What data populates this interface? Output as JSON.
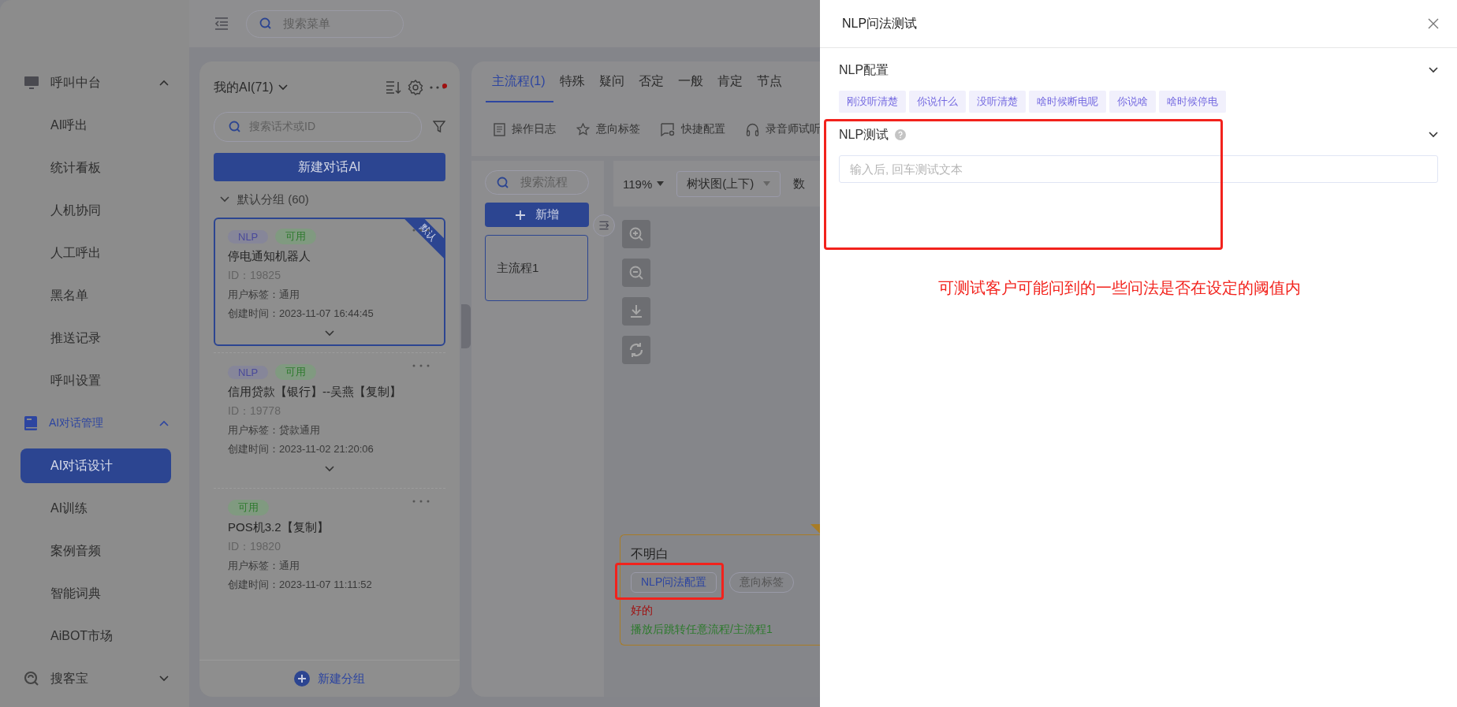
{
  "header": {
    "search_placeholder": "搜索菜单"
  },
  "sidebar": {
    "groups": [
      {
        "label": "呼叫中台",
        "active": false,
        "expanded": true,
        "children": [
          {
            "label": "AI呼出",
            "selected": false
          },
          {
            "label": "统计看板",
            "selected": false
          },
          {
            "label": "人机协同",
            "selected": false
          },
          {
            "label": "人工呼出",
            "selected": false
          },
          {
            "label": "黑名单",
            "selected": false
          },
          {
            "label": "推送记录",
            "selected": false
          },
          {
            "label": "呼叫设置",
            "selected": false
          }
        ]
      },
      {
        "label": "AI对话管理",
        "active": true,
        "expanded": true,
        "children": [
          {
            "label": "AI对话设计",
            "selected": true
          },
          {
            "label": "AI训练",
            "selected": false
          },
          {
            "label": "案例音频",
            "selected": false
          },
          {
            "label": "智能词典",
            "selected": false
          },
          {
            "label": "AiBOT市场",
            "selected": false
          }
        ]
      },
      {
        "label": "搜客宝",
        "active": false,
        "expanded": false
      }
    ]
  },
  "list_panel": {
    "title": "我的AI(71)",
    "search_placeholder": "搜索话术或ID",
    "new_button": "新建对话AI",
    "group": {
      "label": "默认分组",
      "count": "(60)",
      "expanded": true
    },
    "cards": [
      {
        "tags": [
          {
            "label": "NLP",
            "kind": "nlp"
          },
          {
            "label": "可用",
            "kind": "status"
          }
        ],
        "name": "停电通知机器人",
        "id": "ID：19825",
        "user_tag": "用户标签：通用",
        "created": "创建时间：2023-11-07 16:44:45",
        "selected": true,
        "corner_badge": "默认",
        "expand": true
      },
      {
        "tags": [
          {
            "label": "NLP",
            "kind": "nlp"
          },
          {
            "label": "可用",
            "kind": "status"
          }
        ],
        "name": "信用贷款【银行】--吴燕【复制】",
        "id": "ID：19778",
        "user_tag": "用户标签：贷款通用",
        "created": "创建时间：2023-11-02 21:20:06",
        "selected": false,
        "expand": true
      },
      {
        "tags": [
          {
            "label": "可用",
            "kind": "status"
          }
        ],
        "name": "POS机3.2【复制】",
        "id": "ID：19820",
        "user_tag": "用户标签：通用",
        "created": "创建时间：2023-11-07 11:11:52",
        "selected": false,
        "expand": false
      }
    ],
    "footer_button": "新建分组"
  },
  "main": {
    "tabs": [
      {
        "label": "主流程(1)",
        "selected": true
      },
      {
        "label": "特殊",
        "selected": false
      },
      {
        "label": "疑问",
        "selected": false
      },
      {
        "label": "否定",
        "selected": false
      },
      {
        "label": "一般",
        "selected": false
      },
      {
        "label": "肯定",
        "selected": false
      },
      {
        "label": "节点",
        "selected": false
      }
    ],
    "tools": [
      {
        "label": "操作日志",
        "kind": "log"
      },
      {
        "label": "意向标签",
        "kind": "star"
      },
      {
        "label": "快捷配置",
        "kind": "config"
      },
      {
        "label": "录音师试听",
        "kind": "headset"
      }
    ],
    "flow_search_placeholder": "搜索流程",
    "add_button": "新增",
    "flows": [
      {
        "label": "主流程1",
        "selected": true
      }
    ],
    "canvas": {
      "zoom": "119%",
      "layout": "树状图(上下)",
      "column_3": "数"
    },
    "node": {
      "title": "不明白",
      "buttons": [
        {
          "label": "NLP问法配置",
          "kind": "primary"
        },
        {
          "label": "意向标签",
          "kind": "plain"
        }
      ],
      "reply": "好的",
      "action": "播放后跳转任意流程/主流程1"
    }
  },
  "drawer": {
    "title": "NLP问法测试",
    "sections": [
      {
        "title": "NLP配置",
        "help": false,
        "tags": [
          "刚没听清楚",
          "你说什么",
          "没听清楚",
          "啥时候断电呢",
          "你说啥",
          "啥时候停电"
        ]
      },
      {
        "title": "NLP测试",
        "help": true,
        "placeholder": "输入后, 回车测试文本"
      }
    ],
    "annotation": "可测试客户可能问到的一些问法是否在设定的阈值内"
  }
}
